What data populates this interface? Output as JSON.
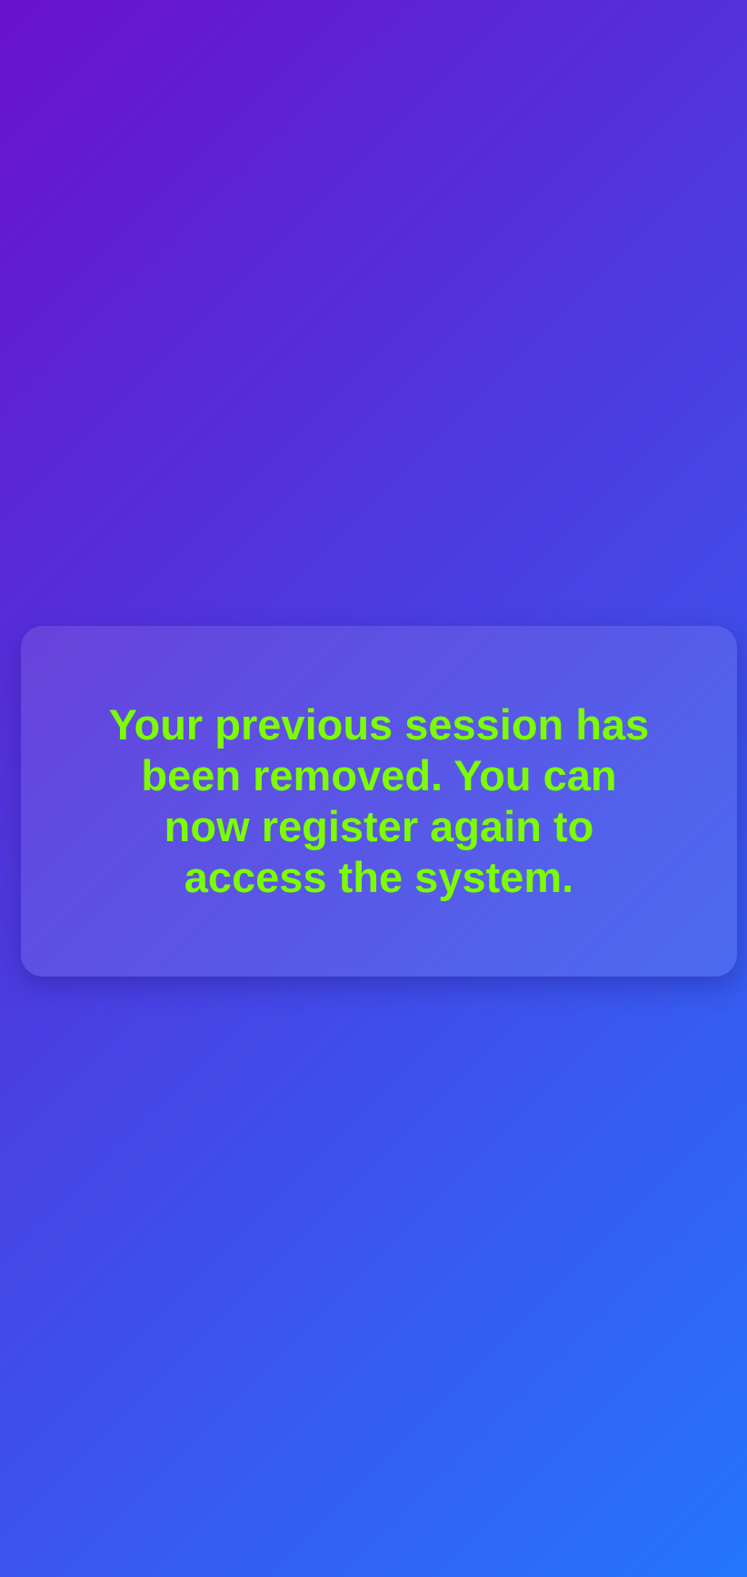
{
  "message": {
    "text": "Your previous session has been removed. You can now register again to access the system."
  },
  "theme": {
    "gradient_start": "#6a11cb",
    "gradient_end": "#2575fc",
    "text_color": "#7cfc00"
  }
}
